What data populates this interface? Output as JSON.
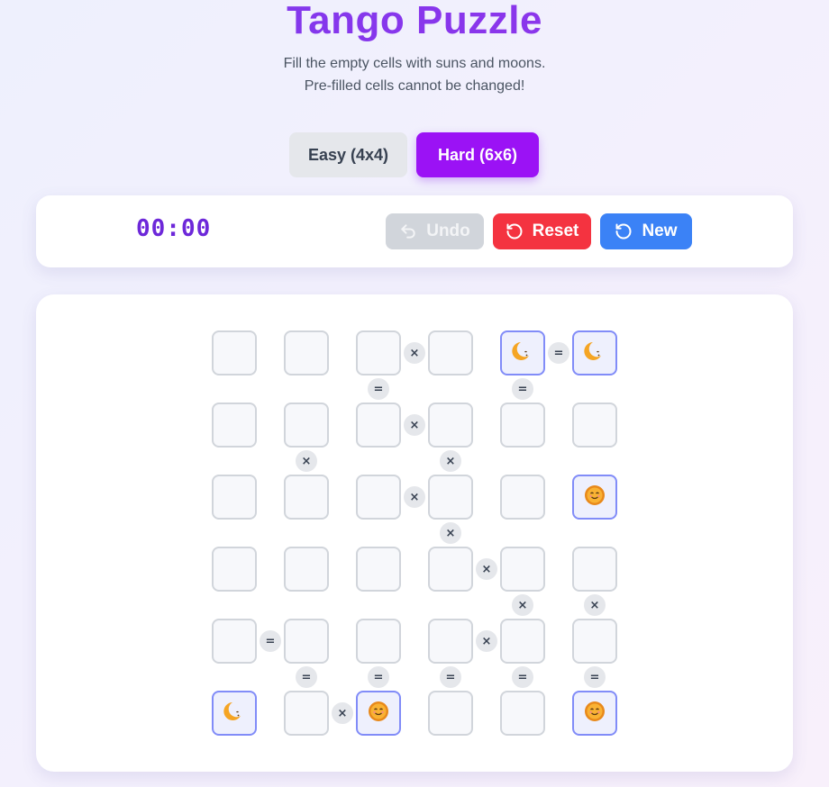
{
  "header": {
    "title": "Tango Puzzle",
    "subtitle_line1": "Fill the empty cells with suns and moons.",
    "subtitle_line2": "Pre-filled cells cannot be changed!"
  },
  "difficulty": {
    "easy_label": "Easy (4x4)",
    "hard_label": "Hard (6x6)",
    "selected": "hard"
  },
  "toolbar": {
    "timer": "00:00",
    "undo_label": "Undo",
    "reset_label": "Reset",
    "new_label": "New"
  },
  "colors": {
    "accent": "#9b12f5",
    "reset": "#f43340",
    "new": "#3b82f6",
    "locked_border": "#818cf8"
  },
  "icons": {
    "undo": "undo-icon",
    "reset": "rotate-ccw-icon",
    "new": "refresh-icon",
    "sun": "sun-emoji-icon",
    "moon": "moon-emoji-icon"
  },
  "board": {
    "size": 6,
    "cells": [
      [
        "",
        "",
        "",
        "",
        "moon",
        "moon"
      ],
      [
        "",
        "",
        "",
        "",
        "",
        ""
      ],
      [
        "",
        "",
        "",
        "",
        "",
        "sun"
      ],
      [
        "",
        "",
        "",
        "",
        "",
        ""
      ],
      [
        "",
        "",
        "",
        "",
        "",
        ""
      ],
      [
        "moon",
        "",
        "sun",
        "",
        "",
        "sun"
      ]
    ],
    "h_constraints": [
      [
        "",
        "",
        "×",
        "",
        "="
      ],
      [
        "",
        "",
        "×",
        "",
        ""
      ],
      [
        "",
        "",
        "×",
        "",
        ""
      ],
      [
        "",
        "",
        "",
        "×",
        ""
      ],
      [
        "=",
        "",
        "",
        "×",
        ""
      ],
      [
        "",
        "×",
        "",
        "",
        ""
      ]
    ],
    "v_constraints": [
      [
        "",
        "",
        "=",
        "",
        "=",
        ""
      ],
      [
        "",
        "×",
        "",
        "×",
        "",
        ""
      ],
      [
        "",
        "",
        "",
        "×",
        "",
        ""
      ],
      [
        "",
        "",
        "",
        "",
        "×",
        "×"
      ],
      [
        "",
        "=",
        "=",
        "=",
        "=",
        "="
      ]
    ]
  }
}
